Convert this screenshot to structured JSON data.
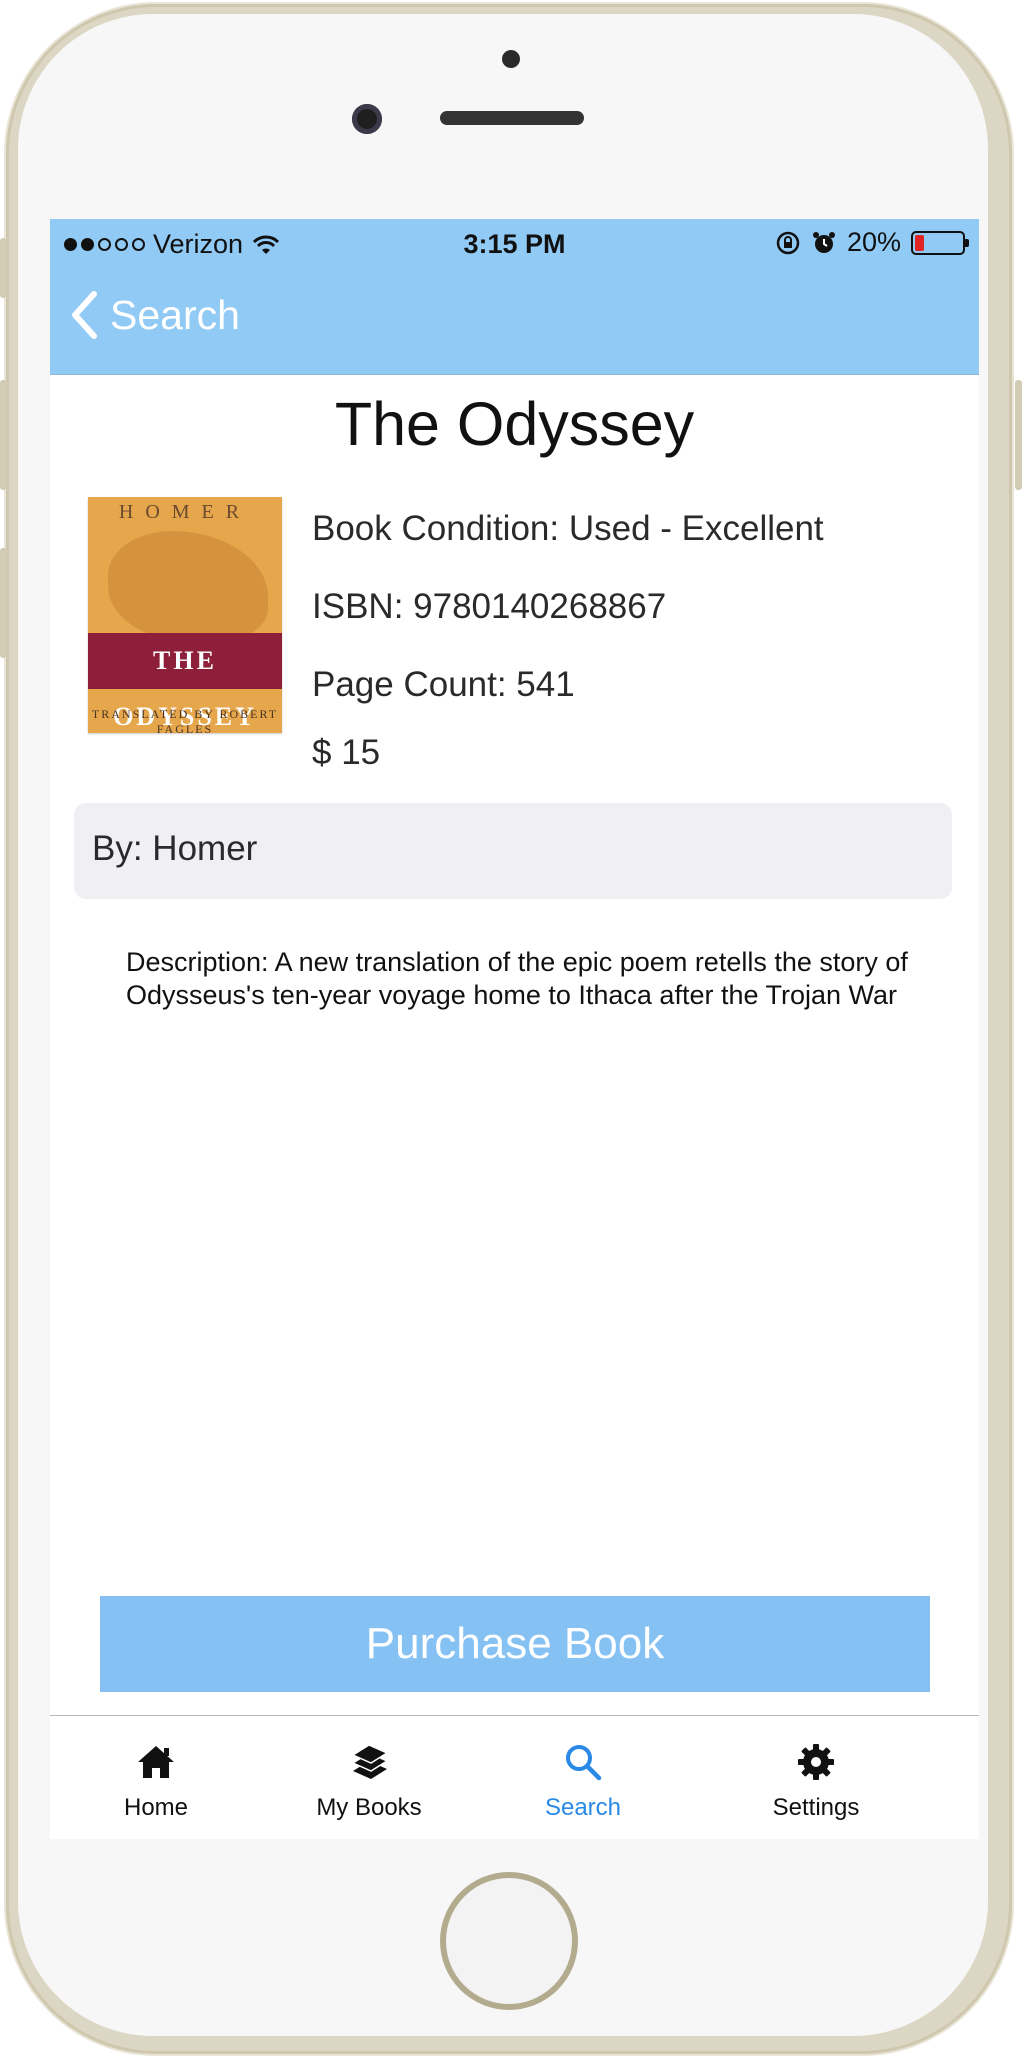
{
  "status_bar": {
    "carrier": "Verizon",
    "time": "3:15 PM",
    "battery": "20%",
    "battery_level": 0.2
  },
  "nav": {
    "back_label": "Search"
  },
  "book": {
    "title": "The Odyssey",
    "cover": {
      "author": "HOMER",
      "title": "THE ODYSSEY",
      "translator": "TRANSLATED BY ROBERT FAGLES"
    },
    "condition": "Book Condition: Used - Excellent",
    "isbn": "ISBN: 9780140268867",
    "page_count": "Page Count: 541",
    "price": "$ 15",
    "author": "By: Homer",
    "description": "Description: A new translation of the epic poem retells the story of Odysseus's ten-year voyage home to Ithaca after the Trojan War"
  },
  "purchase_button": "Purchase Book",
  "tabs": [
    {
      "label": "Home",
      "icon": "home-icon"
    },
    {
      "label": "My Books",
      "icon": "books-icon"
    },
    {
      "label": "Search",
      "icon": "search-icon",
      "active": true
    },
    {
      "label": "Settings",
      "icon": "gear-icon"
    }
  ],
  "colors": {
    "accent": "#90caf5",
    "active_tab": "#2a89e6",
    "battery_low": "#e02424"
  }
}
